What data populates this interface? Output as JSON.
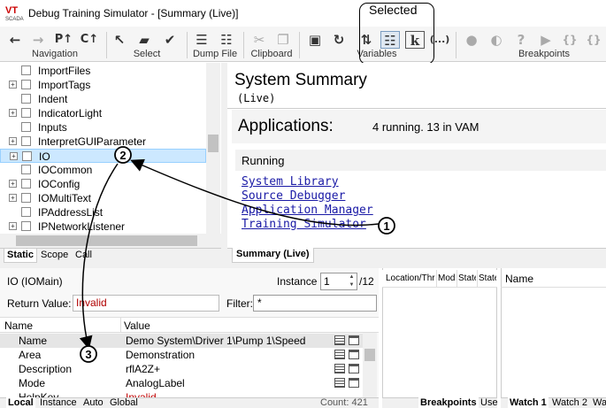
{
  "window": {
    "title": "Debug Training Simulator - [Summary (Live)]",
    "logo_text": "VT",
    "logo_subtext": "SCADA"
  },
  "toolbar": {
    "groups": [
      "Navigation",
      "Select",
      "Dump File",
      "Clipboard",
      "Variables",
      "Breakpoints"
    ],
    "callout_label": "Selected",
    "icons": [
      "back-icon",
      "forward-icon",
      "pt-icon",
      "ct-icon",
      "pointer-icon",
      "folder-icon",
      "checkmark-icon",
      "dump-icon",
      "dump-options-icon",
      "cut-icon",
      "copy-icon",
      "window-icon",
      "refresh-icon",
      "variables-swap-icon",
      "variables-list-icon",
      "k-icon",
      "ellipsis-icon",
      "breakpoint-stop-icon",
      "breakpoint-pause-icon",
      "breakpoint-help-icon",
      "breakpoint-run-icon",
      "breakpoint-step-into-icon",
      "breakpoint-step-over-icon"
    ],
    "glyphs": {
      "back": "←",
      "forward": "→",
      "pt": "P↑",
      "ct": "C↑",
      "pointer": "↖",
      "folder": "▰",
      "check": "✔",
      "dump": "☰",
      "dump2": "☷",
      "cut": "✂",
      "copy": "❐",
      "window": "▣",
      "refresh": "↻",
      "swap": "⇅",
      "list": "☷",
      "k": "k",
      "ellipsis": "(...)",
      "stop": "●",
      "pause": "◐",
      "help": "?",
      "run": "▶",
      "stepin": "{}",
      "stepover": "{}"
    }
  },
  "tree": {
    "items": [
      {
        "label": "ImportFiles",
        "expand": ""
      },
      {
        "label": "ImportTags",
        "expand": "+"
      },
      {
        "label": "Indent",
        "expand": ""
      },
      {
        "label": "IndicatorLight",
        "expand": "+"
      },
      {
        "label": "Inputs",
        "expand": ""
      },
      {
        "label": "InterpretGUIParameter",
        "expand": "+"
      },
      {
        "label": "IO",
        "expand": "+",
        "selected": true
      },
      {
        "label": "IOCommon",
        "expand": ""
      },
      {
        "label": "IOConfig",
        "expand": "+"
      },
      {
        "label": "IOMultiText",
        "expand": "+"
      },
      {
        "label": "IPAddressList",
        "expand": ""
      },
      {
        "label": "IPNetworkListener",
        "expand": "+"
      }
    ],
    "tabs": [
      "Static",
      "Scope",
      "Call"
    ]
  },
  "summary": {
    "title": "System Summary",
    "subtitle": "(Live)",
    "applications_title": "Applications:",
    "applications_status": "4 running. 13 in VAM",
    "running_label": "Running",
    "apps": [
      "System Library",
      "Source Debugger",
      "Application Manager",
      "Training Simulator"
    ],
    "tab": "Summary (Live)"
  },
  "properties": {
    "title": "IO (IOMain)",
    "instance_label": "Instance",
    "instance_value": "1",
    "instance_total": "/12",
    "return_label": "Return Value:",
    "return_value": "Invalid",
    "filter_label": "Filter:",
    "filter_value": "*",
    "columns": [
      "Name",
      "Value"
    ],
    "rows": [
      {
        "name": "Name",
        "value": "Demo System\\Driver 1\\Pump 1\\Speed"
      },
      {
        "name": "Area",
        "value": "Demonstration"
      },
      {
        "name": "Description",
        "value": "rflA2Z+"
      },
      {
        "name": "Mode",
        "value": "AnalogLabel"
      },
      {
        "name": "HelpKey",
        "value": "Invalid"
      }
    ],
    "tabs": [
      "Local",
      "Instance",
      "Auto",
      "Global"
    ],
    "count": "Count: 421"
  },
  "breakpoints": {
    "columns": [
      "Location/Thread",
      "Modu",
      "State",
      "State"
    ],
    "tabs": [
      "Breakpoints",
      "Use"
    ]
  },
  "watch": {
    "column": "Name",
    "tabs": [
      "Watch 1",
      "Watch 2",
      "Wa"
    ]
  },
  "annotations": [
    "1",
    "2",
    "3"
  ]
}
